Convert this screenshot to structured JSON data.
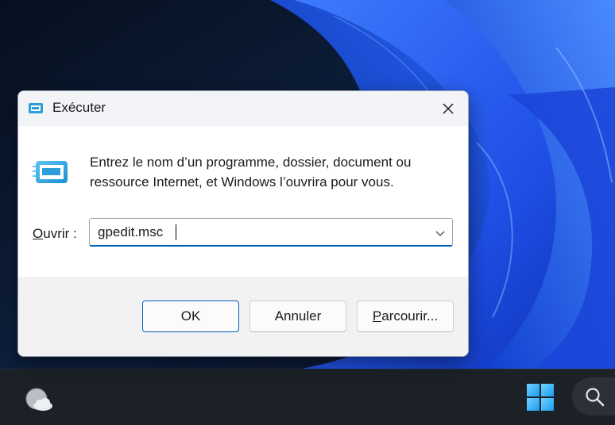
{
  "dialog": {
    "title": "Exécuter",
    "description": "Entrez le nom d’un programme, dossier, document ou ressource Internet, et Windows l’ouvrira pour vous.",
    "open_label_mnemonic": "O",
    "open_label_rest": "uvrir :",
    "input_value": "gpedit.msc",
    "buttons": {
      "ok": "OK",
      "cancel": "Annuler",
      "browse_mnemonic": "P",
      "browse_rest": "arcourir..."
    }
  },
  "taskbar": {
    "widgets_icon": "weather-cloud-icon",
    "start_icon": "windows-logo-icon",
    "search_icon": "search-icon"
  },
  "colors": {
    "accent": "#005fb8",
    "wallpaper_blue": "#1e5bff",
    "taskbar": "#1c2128",
    "windows_logo": "#4cc2ff"
  }
}
